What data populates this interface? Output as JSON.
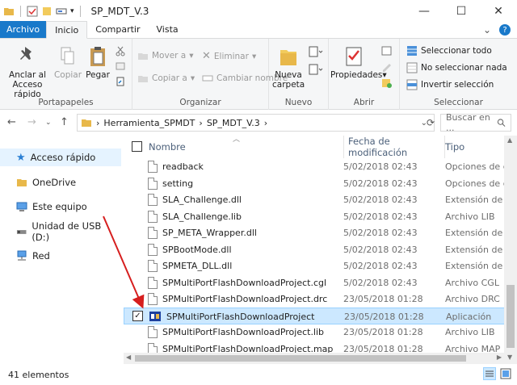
{
  "window": {
    "title": "SP_MDT_V.3"
  },
  "tabs": [
    {
      "label": "Archivo"
    },
    {
      "label": "Inicio"
    },
    {
      "label": "Compartir"
    },
    {
      "label": "Vista"
    }
  ],
  "ribbon": {
    "portapapeles": {
      "label": "Portapapeles",
      "pin": "Anclar al Acceso rápido",
      "copy": "Copiar",
      "paste": "Pegar"
    },
    "organizar": {
      "label": "Organizar",
      "move_to": "Mover a",
      "copy_to": "Copiar a",
      "delete": "Eliminar",
      "rename": "Cambiar nombre"
    },
    "nuevo": {
      "label": "Nuevo",
      "new_folder": "Nueva carpeta"
    },
    "abrir": {
      "label": "Abrir",
      "properties": "Propiedades"
    },
    "seleccionar": {
      "label": "Seleccionar",
      "select_all": "Seleccionar todo",
      "select_none": "No seleccionar nada",
      "invert": "Invertir selección"
    }
  },
  "address": {
    "crumbs": [
      "Herramienta_SPMDT",
      "SP_MDT_V.3"
    ],
    "search_placeholder": "Buscar en ..."
  },
  "nav": [
    {
      "label": "Acceso rápido",
      "icon": "star-icon"
    },
    {
      "label": "OneDrive",
      "icon": "onedrive-folder-icon"
    },
    {
      "label": "Este equipo",
      "icon": "computer-icon"
    },
    {
      "label": "Unidad de USB (D:)",
      "icon": "usb-drive-icon"
    },
    {
      "label": "Red",
      "icon": "network-icon"
    }
  ],
  "columns": {
    "name": "Nombre",
    "date": "Fecha de modificación",
    "type": "Tipo"
  },
  "files": [
    {
      "name": "readback",
      "date": "5/02/2018 02:43",
      "type": "Opciones de co"
    },
    {
      "name": "setting",
      "date": "5/02/2018 02:43",
      "type": "Opciones de co"
    },
    {
      "name": "SLA_Challenge.dll",
      "date": "5/02/2018 02:43",
      "type": "Extensión de la"
    },
    {
      "name": "SLA_Challenge.lib",
      "date": "5/02/2018 02:43",
      "type": "Archivo LIB"
    },
    {
      "name": "SP_META_Wrapper.dll",
      "date": "5/02/2018 02:43",
      "type": "Extensión de la"
    },
    {
      "name": "SPBootMode.dll",
      "date": "5/02/2018 02:43",
      "type": "Extensión de la"
    },
    {
      "name": "SPMETA_DLL.dll",
      "date": "5/02/2018 02:43",
      "type": "Extensión de la"
    },
    {
      "name": "SPMultiPortFlashDownloadProject.cgl",
      "date": "5/02/2018 02:43",
      "type": "Archivo CGL"
    },
    {
      "name": "SPMultiPortFlashDownloadProject.drc",
      "date": "23/05/2018 01:28",
      "type": "Archivo DRC"
    },
    {
      "name": "SPMultiPortFlashDownloadProject",
      "date": "23/05/2018 01:28",
      "type": "Aplicación",
      "selected": true
    },
    {
      "name": "SPMultiPortFlashDownloadProject.lib",
      "date": "23/05/2018 01:28",
      "type": "Archivo LIB"
    },
    {
      "name": "SPMultiPortFlashDownloadProject.map",
      "date": "23/05/2018 01:28",
      "type": "Archivo MAP"
    }
  ],
  "status": {
    "count": "41 elementos"
  },
  "colors": {
    "accent": "#1979ca",
    "selection": "#cce8ff",
    "annotation_arrow": "#d61e1e"
  }
}
